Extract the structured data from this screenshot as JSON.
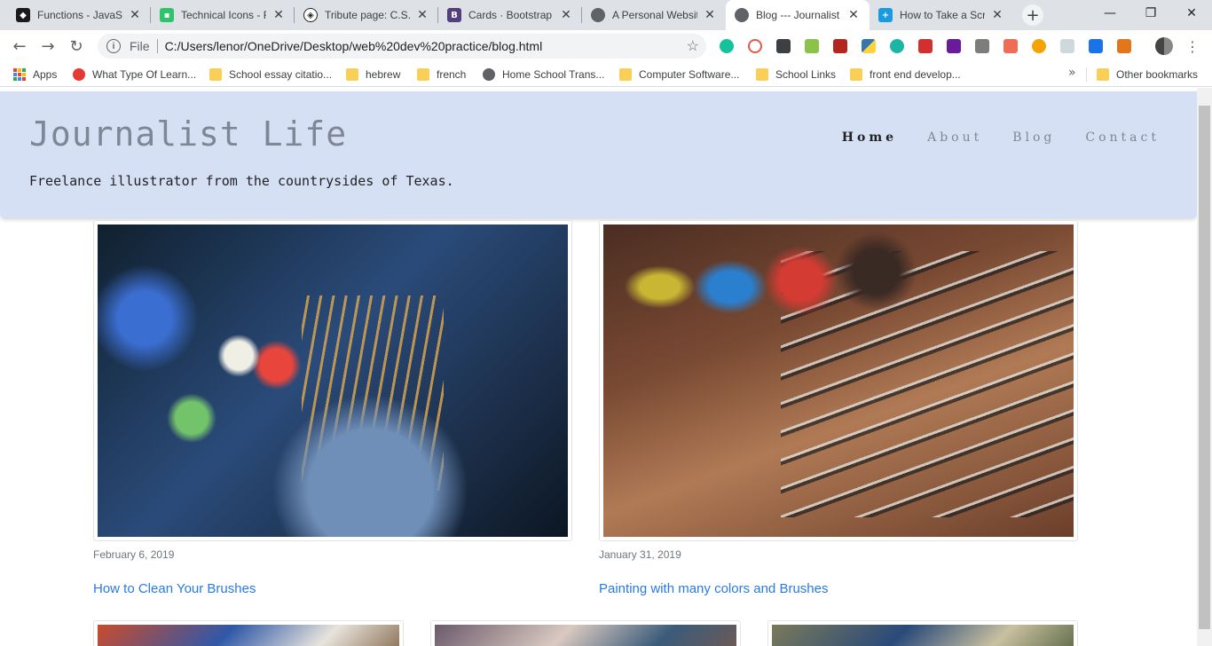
{
  "browser": {
    "tabs": [
      {
        "title": "Functions - JavaScript",
        "favicon_color": "#1a1a1a",
        "active": false
      },
      {
        "title": "Technical Icons - Font",
        "favicon_color": "#2dc46a",
        "active": false
      },
      {
        "title": "Tribute page: C.S.Lewis",
        "favicon_color": "#222222",
        "active": false
      },
      {
        "title": "Cards · Bootstrap",
        "favicon_color": "#563d7c",
        "active": false
      },
      {
        "title": "A Personal Website",
        "favicon_color": "#5f6368",
        "active": false
      },
      {
        "title": "Blog --- Journalist Life",
        "favicon_color": "#5f6368",
        "active": true
      },
      {
        "title": "How to Take a Screenshot",
        "favicon_color": "#1a9ae0",
        "active": false
      }
    ],
    "url_scheme": "File",
    "url": "C:/Users/lenor/OneDrive/Desktop/web%20dev%20practice/blog.html",
    "bookmarks": [
      {
        "label": "Apps",
        "icon": "apps-grid-icon"
      },
      {
        "label": "What Type Of Learn...",
        "icon": "chart-icon"
      },
      {
        "label": "School essay citatio...",
        "icon": "folder-icon"
      },
      {
        "label": "hebrew",
        "icon": "folder-icon"
      },
      {
        "label": "french",
        "icon": "folder-icon"
      },
      {
        "label": "Home School Trans...",
        "icon": "globe-icon"
      },
      {
        "label": "Computer Software...",
        "icon": "folder-icon"
      },
      {
        "label": "School Links",
        "icon": "folder-icon"
      },
      {
        "label": "front end develop...",
        "icon": "folder-icon"
      }
    ],
    "bookmarks_overflow": "»",
    "other_bookmarks": "Other bookmarks"
  },
  "site": {
    "title": "Journalist Life",
    "tagline": "Freelance illustrator from the countrysides of Texas.",
    "nav": [
      "Home",
      "About",
      "Blog",
      "Contact"
    ],
    "current_nav": "Home"
  },
  "posts": [
    {
      "date": "February 6, 2019",
      "title": "How to Clean Your Brushes"
    },
    {
      "date": "January 31, 2019",
      "title": "Painting with many colors and Brushes"
    }
  ],
  "colors": {
    "header_bg": "#d6e0f5",
    "title_color": "#7d8796",
    "link_color": "#2a7ae2"
  }
}
